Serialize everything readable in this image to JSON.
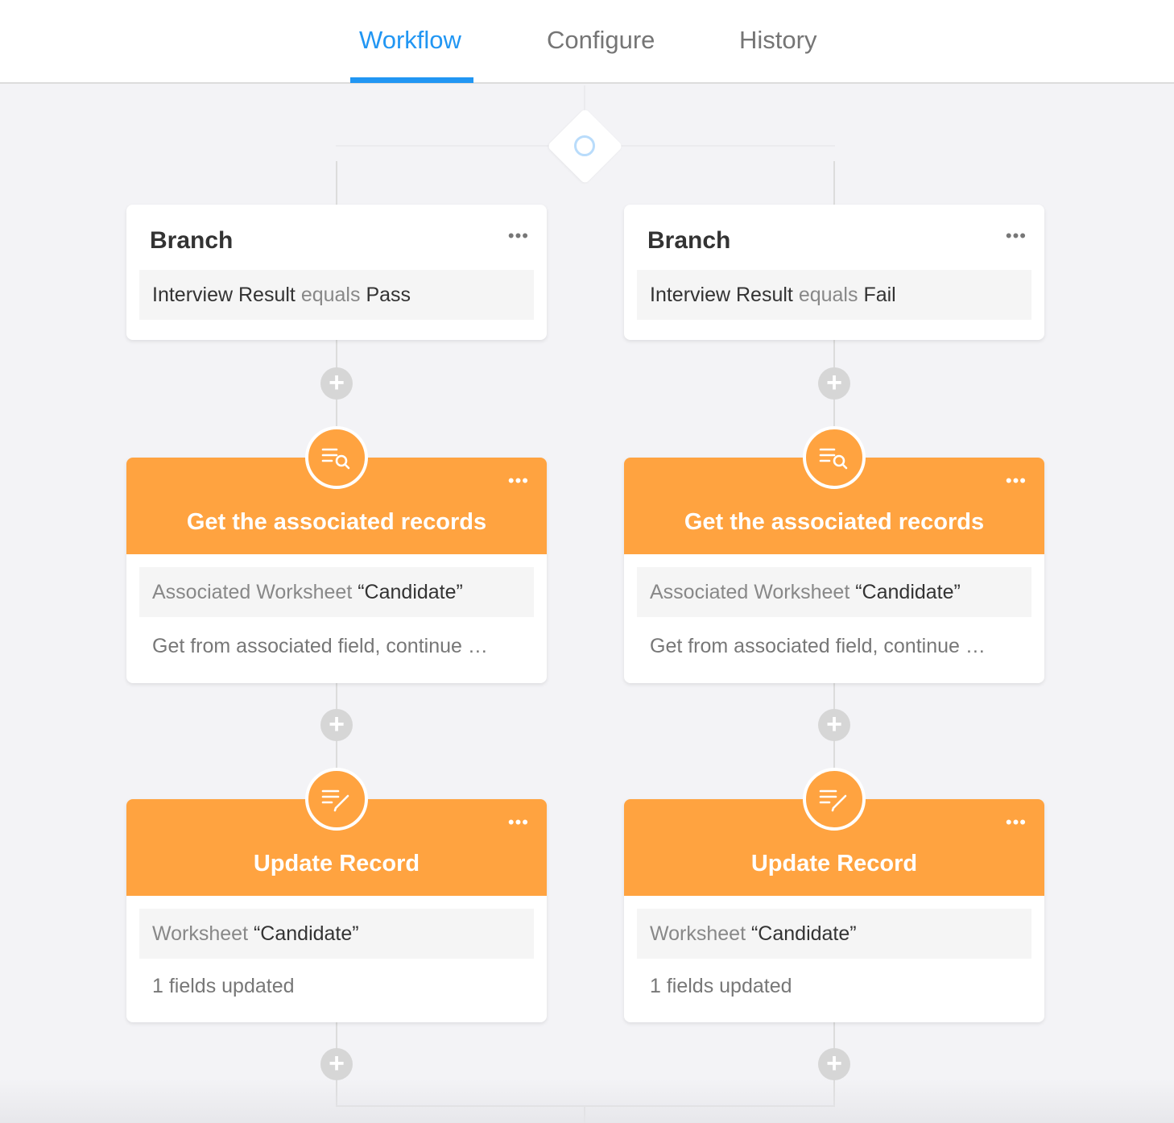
{
  "tabs": [
    {
      "label": "Workflow",
      "active": true
    },
    {
      "label": "Configure",
      "active": false
    },
    {
      "label": "History",
      "active": false
    }
  ],
  "branches": [
    {
      "branch": {
        "title": "Branch",
        "field": "Interview Result",
        "operator": "equals",
        "value": "Pass"
      },
      "get_records": {
        "title": "Get the associated records",
        "label": "Associated Worksheet",
        "value": "“Candidate”",
        "description": "Get from associated field, continue …"
      },
      "update_record": {
        "title": "Update Record",
        "label": "Worksheet",
        "value": "“Candidate”",
        "description": "1 fields updated"
      }
    },
    {
      "branch": {
        "title": "Branch",
        "field": "Interview Result",
        "operator": "equals",
        "value": "Fail"
      },
      "get_records": {
        "title": "Get the associated records",
        "label": "Associated Worksheet",
        "value": "“Candidate”",
        "description": "Get from associated field, continue …"
      },
      "update_record": {
        "title": "Update Record",
        "label": "Worksheet",
        "value": "“Candidate”",
        "description": "1 fields updated"
      }
    }
  ],
  "icons": {
    "more": "•••",
    "add": "+",
    "get_records_icon": "list-search-icon",
    "update_record_icon": "list-edit-icon"
  },
  "colors": {
    "accent": "#2196f3",
    "node_orange": "#ffa340",
    "branch_ring": "#b9dcfb"
  }
}
